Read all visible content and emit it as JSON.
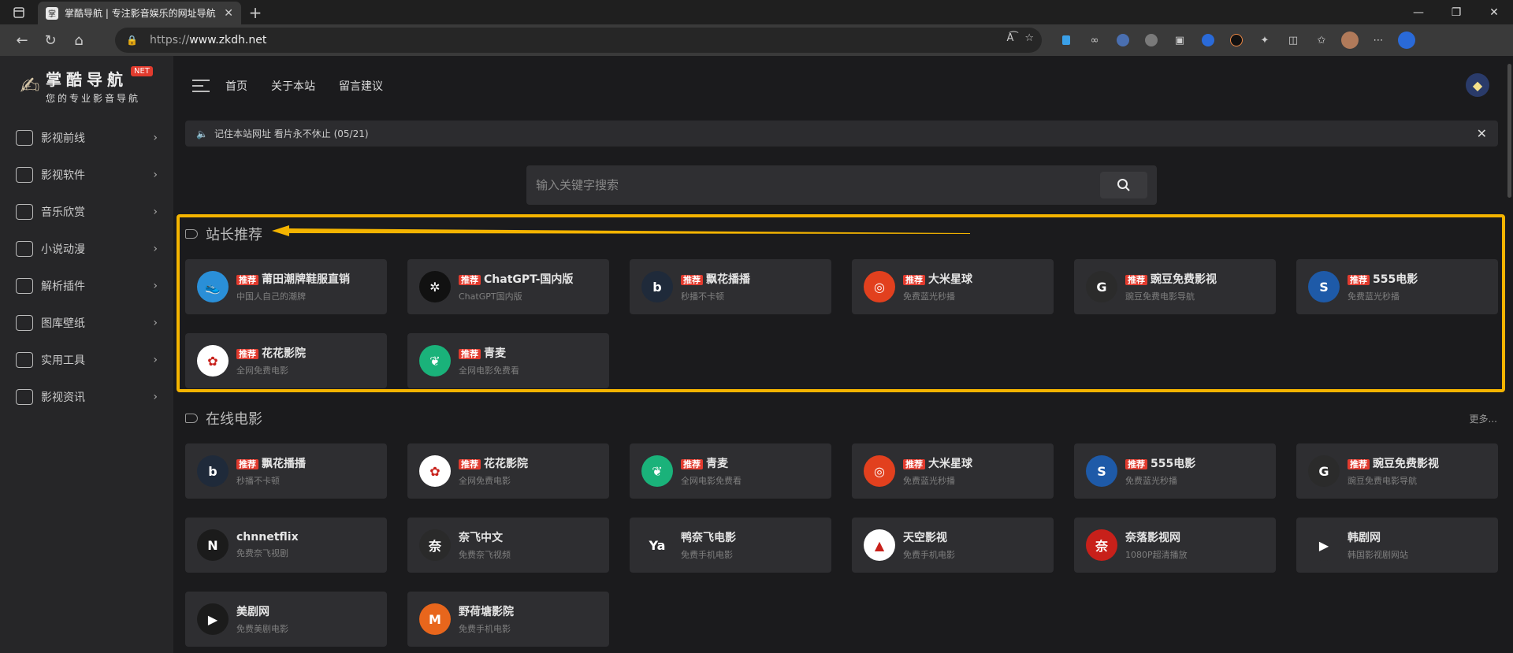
{
  "browser": {
    "tab_title": "掌酷导航 | 专注影音娱乐的网址导航",
    "url_prefix": "https://",
    "url_host": "www.zkdh.net"
  },
  "site": {
    "logo_title": "掌酷导航",
    "logo_net": "NET",
    "logo_subtitle": "您的专业影音导航"
  },
  "sidebar": {
    "items": [
      {
        "label": "影视前线",
        "icon": "play-icon"
      },
      {
        "label": "影视软件",
        "icon": "grid-icon"
      },
      {
        "label": "音乐欣赏",
        "icon": "music-icon"
      },
      {
        "label": "小说动漫",
        "icon": "book-icon"
      },
      {
        "label": "解析插件",
        "icon": "plugin-icon"
      },
      {
        "label": "图库壁纸",
        "icon": "image-icon"
      },
      {
        "label": "实用工具",
        "icon": "tool-icon"
      },
      {
        "label": "影视资讯",
        "icon": "news-icon"
      }
    ]
  },
  "topnav": {
    "links": [
      "首页",
      "关于本站",
      "留言建议"
    ]
  },
  "notice": {
    "text": "记住本站网址 看片永不休止 (05/21)"
  },
  "search": {
    "placeholder": "输入关键字搜索"
  },
  "sections": {
    "recommended": {
      "title": "站长推荐",
      "cards": [
        {
          "badge": "推荐",
          "name": "莆田潮牌鞋服直销",
          "desc": "中国人自己的潮牌",
          "icon_color": "#2a8fd8",
          "glyph": "👟"
        },
        {
          "badge": "推荐",
          "name": "ChatGPT-国内版",
          "desc": "ChatGPT国内版",
          "icon_color": "#111111",
          "glyph": "✲"
        },
        {
          "badge": "推荐",
          "name": "飘花播播",
          "desc": "秒播不卡顿",
          "icon_color": "#1f2a3a",
          "glyph": "b"
        },
        {
          "badge": "推荐",
          "name": "大米星球",
          "desc": "免费蓝光秒播",
          "icon_color": "#e2401e",
          "glyph": "◎"
        },
        {
          "badge": "推荐",
          "name": "豌豆免费影视",
          "desc": "豌豆免费电影导航",
          "icon_color": "#2b2b2b",
          "glyph": "G"
        },
        {
          "badge": "推荐",
          "name": "555电影",
          "desc": "免费蓝光秒播",
          "icon_color": "#1e5aa8",
          "glyph": "S"
        },
        {
          "badge": "推荐",
          "name": "花花影院",
          "desc": "全网免费电影",
          "icon_color": "#ffffff",
          "glyph": "✿"
        },
        {
          "badge": "推荐",
          "name": "青麦",
          "desc": "全网电影免费看",
          "icon_color": "#1ab27a",
          "glyph": "❦"
        }
      ]
    },
    "online": {
      "title": "在线电影",
      "more": "更多...",
      "cards": [
        {
          "badge": "推荐",
          "name": "飘花播播",
          "desc": "秒播不卡顿",
          "icon_color": "#1f2a3a",
          "glyph": "b"
        },
        {
          "badge": "推荐",
          "name": "花花影院",
          "desc": "全网免费电影",
          "icon_color": "#ffffff",
          "glyph": "✿"
        },
        {
          "badge": "推荐",
          "name": "青麦",
          "desc": "全网电影免费看",
          "icon_color": "#1ab27a",
          "glyph": "❦"
        },
        {
          "badge": "推荐",
          "name": "大米星球",
          "desc": "免费蓝光秒播",
          "icon_color": "#e2401e",
          "glyph": "◎"
        },
        {
          "badge": "推荐",
          "name": "555电影",
          "desc": "免费蓝光秒播",
          "icon_color": "#1e5aa8",
          "glyph": "S"
        },
        {
          "badge": "推荐",
          "name": "豌豆免费影视",
          "desc": "豌豆免费电影导航",
          "icon_color": "#2b2b2b",
          "glyph": "G"
        },
        {
          "badge": "",
          "name": "chnnetflix",
          "desc": "免费奈飞视剧",
          "icon_color": "#1b1b1b",
          "glyph": "N"
        },
        {
          "badge": "",
          "name": "奈飞中文",
          "desc": "免费奈飞视频",
          "icon_color": "#2a2a2a",
          "glyph": "奈"
        },
        {
          "badge": "",
          "name": "鸭奈飞电影",
          "desc": "免费手机电影",
          "icon_color": "#2e2e31",
          "glyph": "Ya"
        },
        {
          "badge": "",
          "name": "天空影视",
          "desc": "免费手机电影",
          "icon_color": "#ffffff",
          "glyph": "▲"
        },
        {
          "badge": "",
          "name": "奈落影视网",
          "desc": "1080P超清播放",
          "icon_color": "#c8201a",
          "glyph": "奈"
        },
        {
          "badge": "",
          "name": "韩剧网",
          "desc": "韩国影视剧网站",
          "icon_color": "#2e2e31",
          "glyph": "▶"
        },
        {
          "badge": "",
          "name": "美剧网",
          "desc": "免费美剧电影",
          "icon_color": "#1b1b1b",
          "glyph": "▶"
        },
        {
          "badge": "",
          "name": "野荷塘影院",
          "desc": "免费手机电影",
          "icon_color": "#e8661c",
          "glyph": "M"
        }
      ]
    }
  },
  "colors": {
    "accent_highlight": "#f4b400",
    "badge_red": "#e23b2e"
  }
}
